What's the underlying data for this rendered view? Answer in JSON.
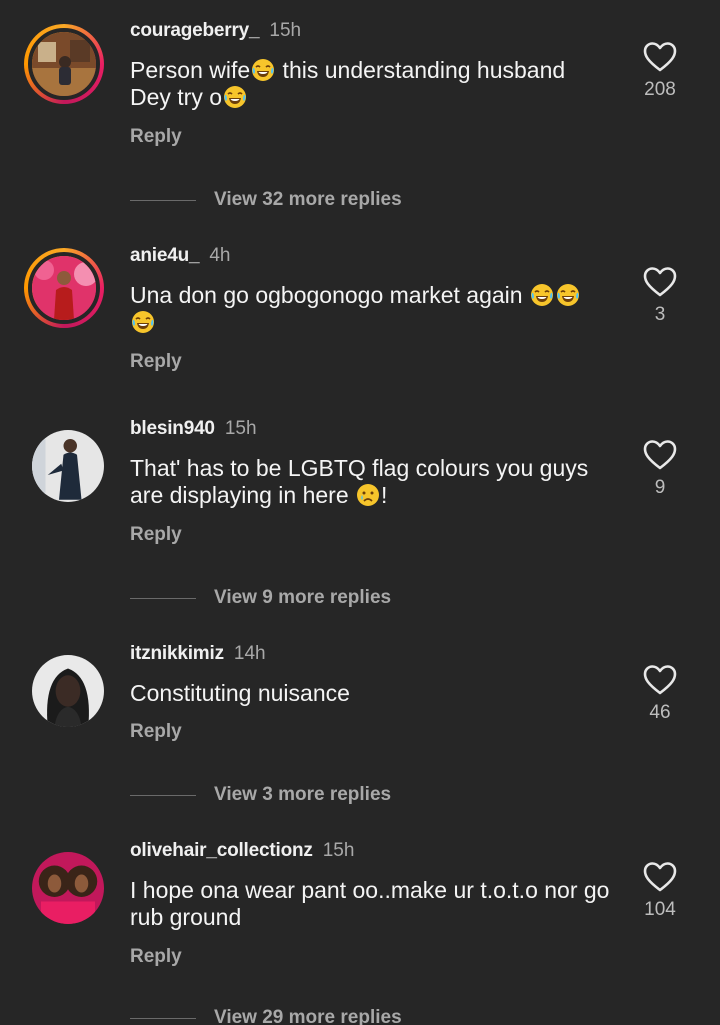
{
  "comments": [
    {
      "username": "courageberry_",
      "time": "15h",
      "text_parts": [
        "Person wife",
        " this understanding husband Dey try o"
      ],
      "likes": "208",
      "reply_label": "Reply",
      "view_more": "View 32 more replies"
    },
    {
      "username": "anie4u_",
      "time": "4h",
      "text_parts": [
        "Una don go ogbogonogo market again "
      ],
      "likes": "3",
      "reply_label": "Reply"
    },
    {
      "username": "blesin940",
      "time": "15h",
      "text_parts": [
        "That' has to be LGBTQ flag colours you guys are displaying in here ",
        "!"
      ],
      "likes": "9",
      "reply_label": "Reply",
      "view_more": "View 9 more replies"
    },
    {
      "username": "itznikkimiz",
      "time": "14h",
      "text_parts": [
        "Constituting nuisance"
      ],
      "likes": "46",
      "reply_label": "Reply",
      "view_more": "View 3 more replies"
    },
    {
      "username": "olivehair_collectionz",
      "time": "15h",
      "text_parts": [
        "I hope ona wear pant oo..make ur t.o.t.o nor go rub ground"
      ],
      "likes": "104",
      "reply_label": "Reply",
      "view_more": "View 29 more replies"
    }
  ],
  "icons": {
    "heart": "heart-outline-icon",
    "emoji_laugh": "tears-of-joy-emoji",
    "emoji_cry": "crying-face-emoji"
  },
  "colors": {
    "background": "#262626",
    "muted_text": "#a8a8a8",
    "primary_text": "#f4f4f4"
  }
}
